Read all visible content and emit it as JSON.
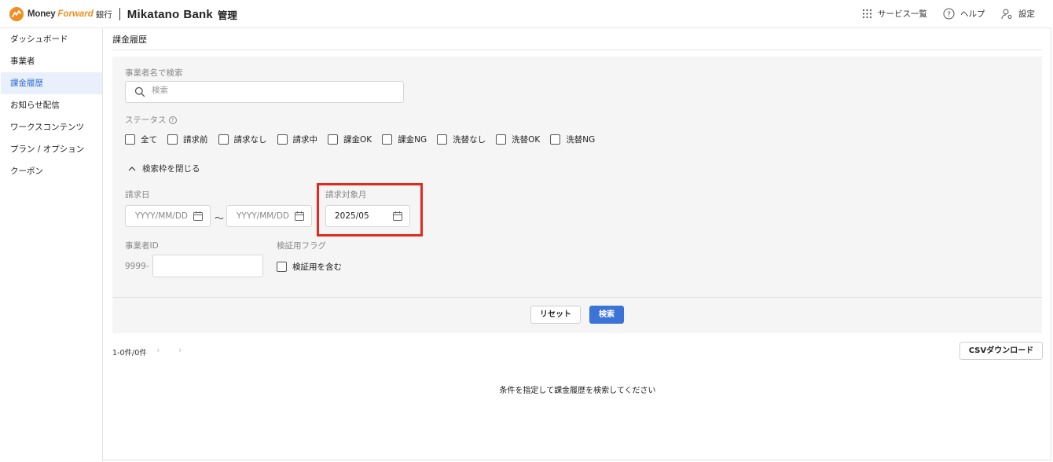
{
  "header": {
    "brand_1": "Money",
    "brand_2": "Forward",
    "brand_3": "銀行",
    "product": "Mikatano",
    "product_2": "Bank",
    "product_sub": "管理",
    "menu": {
      "services": "サービス一覧",
      "help": "ヘルプ",
      "settings": "設定"
    }
  },
  "sidebar": {
    "items": [
      {
        "label": "ダッシュボード",
        "active": false
      },
      {
        "label": "事業者",
        "active": false
      },
      {
        "label": "課金履歴",
        "active": true
      },
      {
        "label": "お知らせ配信",
        "active": false
      },
      {
        "label": "ワークスコンテンツ",
        "active": false
      },
      {
        "label": "プラン / オプション",
        "active": false
      },
      {
        "label": "クーポン",
        "active": false
      }
    ]
  },
  "main": {
    "title": "課金履歴",
    "search": {
      "label": "事業者名で検索",
      "placeholder": "検索"
    },
    "status": {
      "label": "ステータス",
      "help": "?",
      "options": [
        "全て",
        "請求前",
        "請求なし",
        "請求中",
        "課金OK",
        "課金NG",
        "洗替なし",
        "洗替OK",
        "洗替NG"
      ]
    },
    "toggle_label": "検索枠を閉じる",
    "billing_date": {
      "label": "請求日",
      "from_placeholder": "YYYY/MM/DD",
      "to_placeholder": "YYYY/MM/DD",
      "separator": "〜"
    },
    "target_month": {
      "label": "請求対象月",
      "value": "2025/05"
    },
    "business_id": {
      "label": "事業者ID",
      "prefix": "9999-",
      "value": ""
    },
    "verify_flag": {
      "label": "検証用フラグ",
      "option": "検証用を含む"
    },
    "buttons": {
      "reset": "リセット",
      "search": "検索",
      "csv": "CSVダウンロード"
    },
    "pagination": {
      "count": "1-0件/0件",
      "prev": "‹",
      "next": "›"
    },
    "empty_message": "条件を指定して課金履歴を検索してください"
  },
  "colors": {
    "accent": "#3b74d6",
    "brand_orange": "#f08e22",
    "highlight": "#e02a1f",
    "active_bg": "#e9f0fb"
  }
}
